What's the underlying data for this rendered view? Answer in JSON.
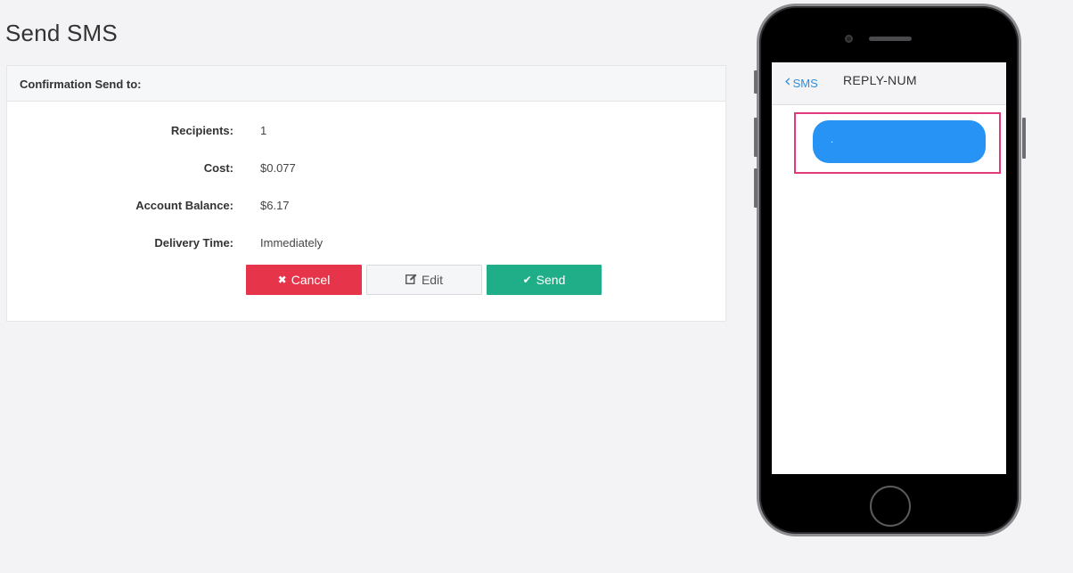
{
  "page": {
    "title": "Send SMS"
  },
  "confirmation": {
    "heading": "Confirmation Send to:",
    "rows": [
      {
        "label": "Recipients:",
        "value": "1"
      },
      {
        "label": "Cost:",
        "value": "$0.077"
      },
      {
        "label": "Account Balance:",
        "value": "$6.17"
      },
      {
        "label": "Delivery Time:",
        "value": "Immediately"
      }
    ]
  },
  "buttons": {
    "cancel": {
      "label": "Cancel",
      "icon": "times-icon",
      "color": "#e6344a"
    },
    "edit": {
      "label": "Edit",
      "icon": "edit-icon"
    },
    "send": {
      "label": "Send",
      "icon": "check-icon",
      "color": "#1fae87"
    }
  },
  "phone_preview": {
    "back_label": "SMS",
    "contact": "REPLY-NUM",
    "message_text": ".",
    "bubble_color": "#2793f5",
    "highlight_color": "#e23a7c"
  }
}
